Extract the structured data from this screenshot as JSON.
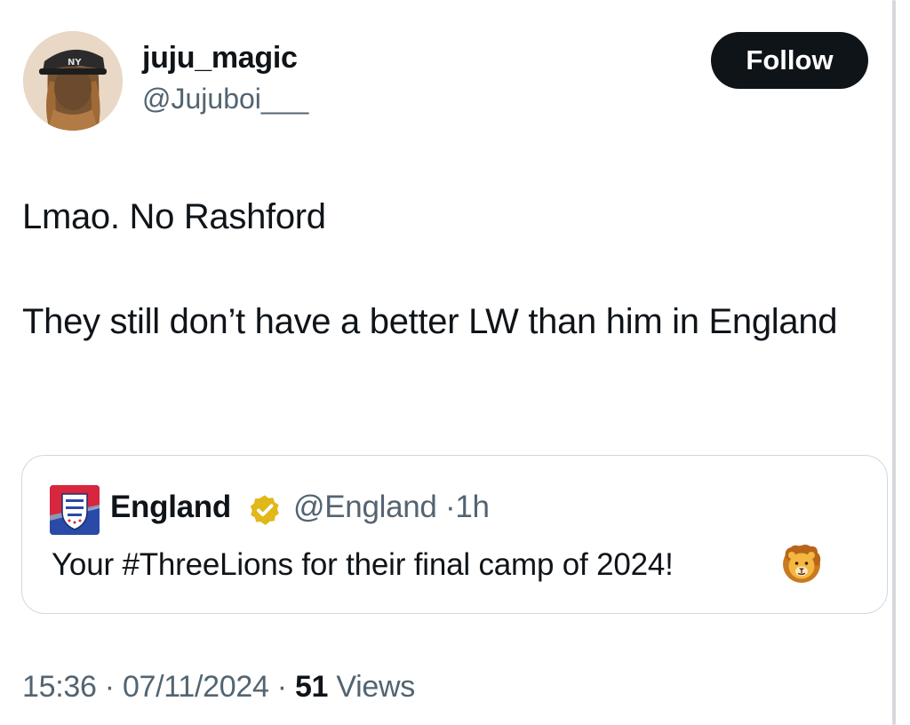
{
  "author": {
    "display_name": "juju_magic",
    "handle": "@Jujuboi___"
  },
  "follow_button": {
    "label": "Follow"
  },
  "tweet": {
    "paragraphs": [
      "Lmao. No Rashford",
      "They still don’t have a better LW than him in England"
    ]
  },
  "quoted_tweet": {
    "display_name": "England",
    "handle": "@England",
    "separator": "·",
    "time_ago": "1h",
    "text": "Your #ThreeLions for their final camp of 2024!",
    "emoji_icon": "lion-face-emoji"
  },
  "footer": {
    "time": "15:36",
    "separator": "·",
    "date": "07/11/2024",
    "views_count": "51",
    "views_label": "Views"
  },
  "colors": {
    "text_primary": "#0f1419",
    "text_secondary": "#536471",
    "border": "#cfd9de",
    "verified_gold": "#e2b719"
  }
}
